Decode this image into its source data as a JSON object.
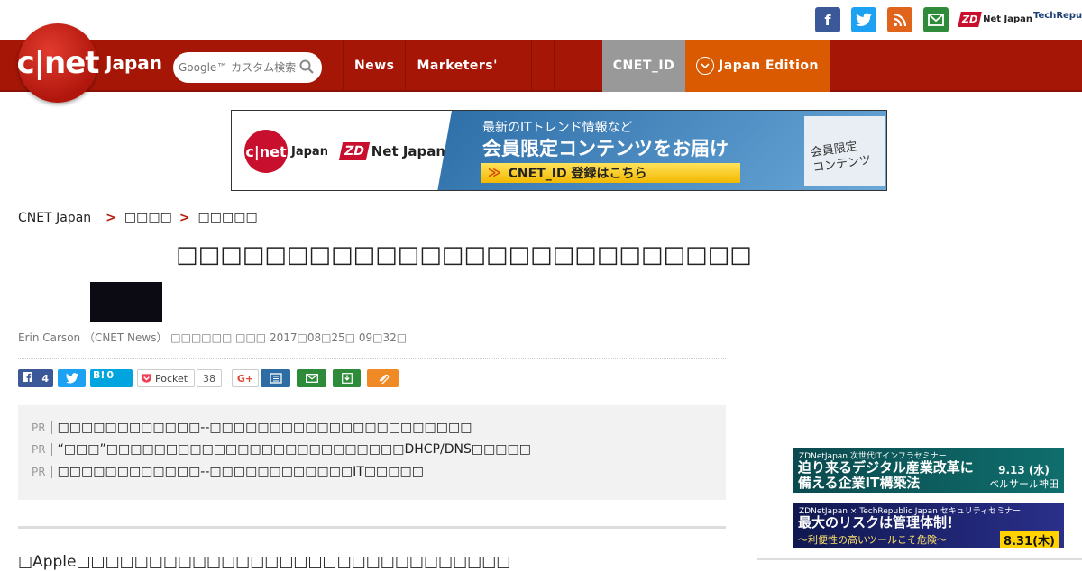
{
  "social": {
    "facebook_icon": "facebook-icon",
    "twitter_icon": "twitter-icon",
    "rss_icon": "rss-icon",
    "mail_icon": "mail-icon",
    "zdnet_mark": "ZD",
    "zdnet_label": "Net Japan",
    "techrepublic_label": "TechRepublic"
  },
  "header": {
    "logo_text": "c|net",
    "logo_region": "Japan",
    "search_placeholder": "Google™ カスタム検索",
    "nav": [
      {
        "label": "News"
      },
      {
        "label": "Marketers'"
      },
      {
        "label": ""
      },
      {
        "label": ""
      },
      {
        "label": ""
      }
    ],
    "cnet_id_label": "CNET_ID",
    "edition_label": "Japan Edition"
  },
  "banner": {
    "cnet_logo": "c|net",
    "cnet_japan": "Japan",
    "zdnet_mark": "ZD",
    "zdnet_text": "Net Japan",
    "line1": "最新のITトレンド情報など",
    "line2": "会員限定コンテンツをお届け",
    "button_arrow": "≫",
    "button_text": "CNET_ID 登録はこちら",
    "side_line1": "会員限定",
    "side_line2": "コンテンツ"
  },
  "breadcrumb": {
    "home": "CNET Japan",
    "sep1": ">",
    "level2": "□□□□",
    "sep2": ">",
    "level3": "□□□□□"
  },
  "article": {
    "title": "□□□□□□□□□□□□□□□□□□□□□□□□□□",
    "byline": "Erin Carson （CNET News） □□□□□□ □□□ 2017□08□25□ 09□32□",
    "lead": "□Apple□□□□□□□□□□□□□□□□□□□□□□□□□□□□□□"
  },
  "share": {
    "facebook_count": "4",
    "hatena_label": "B!",
    "hatena_count": "0",
    "pocket_label": "Pocket",
    "pocket_count": "38",
    "gplus_label": "G+"
  },
  "pr": [
    {
      "tag": "PR",
      "text": "□□□□□□□□□□□□--□□□□□□□□□□□□□□□□□□□□□□"
    },
    {
      "tag": "PR",
      "text": "“□□□”□□□□□□□□□□□□□□□□□□□□□□□□□DHCP/DNS□□□□□"
    },
    {
      "tag": "PR",
      "text": "□□□□□□□□□□□□--□□□□□□□□□□□□IT□□□□□"
    }
  ],
  "side_ads": [
    {
      "small": "ZDNetJapan 次世代ITインフラセミナー",
      "big1": "迫り来るデジタル産業改革に",
      "big2": "備える企業IT構築法",
      "date": "9.13 (水)",
      "venue": "ベルサール神田"
    },
    {
      "small": "ZDNetJapan × TechRepublic Japan セキュリティセミナー",
      "big1": "最大のリスクは管理体制！",
      "sub": "〜利便性の高いツールこそ危険〜",
      "date": "8.31(木)"
    }
  ],
  "colors": {
    "header_red": "#a51606",
    "edition_orange": "#d95a00",
    "id_gray": "#999999",
    "facebook": "#3b5998",
    "twitter": "#1da1f2",
    "rss": "#e0641c",
    "mail": "#2e8b3a"
  }
}
